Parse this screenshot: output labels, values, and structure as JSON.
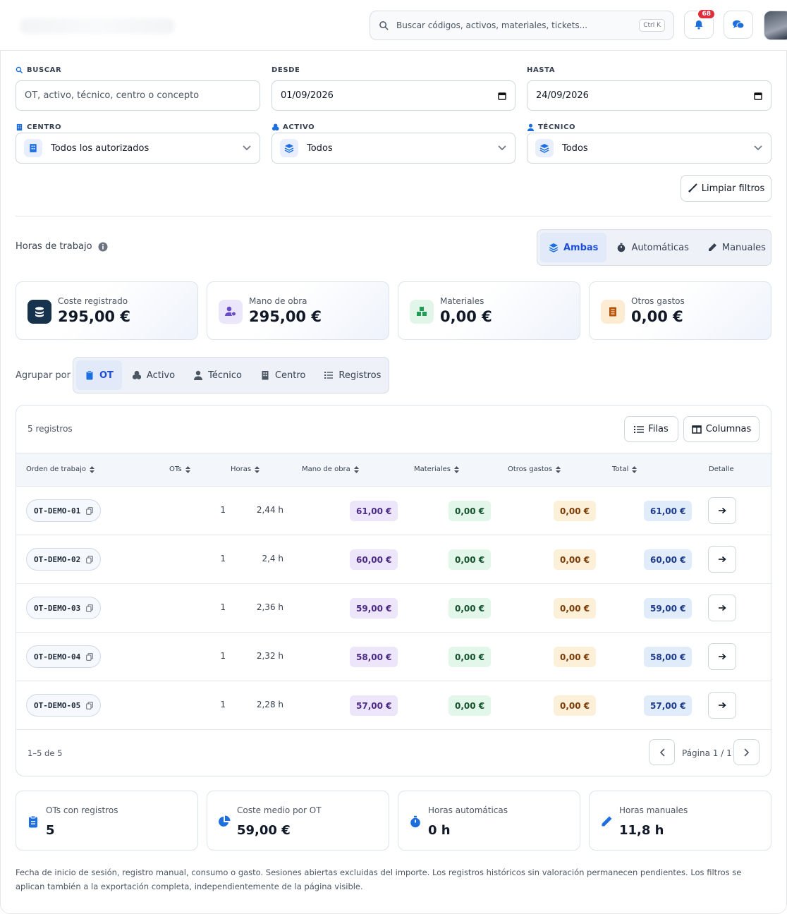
{
  "topbar": {
    "search_placeholder": "Buscar códigos, activos, materiales, tickets...",
    "shortcut": "Ctrl K",
    "notifications_count": "68"
  },
  "filters": {
    "search_label": "BUSCAR",
    "search_placeholder": "OT, activo, técnico, centro o concepto",
    "from_label": "DESDE",
    "from_value": "01/09/2026",
    "to_label": "HASTA",
    "to_value": "24/09/2026",
    "center_label": "CENTRO",
    "center_value": "Todos los autorizados",
    "asset_label": "ACTIVO",
    "asset_value": "Todos",
    "tech_label": "TÉCNICO",
    "tech_value": "Todos",
    "clear_label": "Limpiar filtros"
  },
  "hours": {
    "title": "Horas de trabajo",
    "modes": [
      "Ambas",
      "Automáticas",
      "Manuales"
    ],
    "active_mode": "Ambas"
  },
  "summary_cards": [
    {
      "label": "Coste registrado",
      "value": "295,00 €",
      "icon": "coins-icon"
    },
    {
      "label": "Mano de obra",
      "value": "295,00 €",
      "icon": "user-cost-icon"
    },
    {
      "label": "Materiales",
      "value": "0,00 €",
      "icon": "boxes-icon"
    },
    {
      "label": "Otros gastos",
      "value": "0,00 €",
      "icon": "receipt-icon"
    }
  ],
  "group": {
    "label": "Agrupar por",
    "options": [
      "OT",
      "Activo",
      "Técnico",
      "Centro",
      "Registros"
    ],
    "active": "OT"
  },
  "table": {
    "count_text": "5 registros",
    "rows_button": "Filas",
    "columns_button": "Columnas",
    "headers": [
      "Orden de trabajo",
      "OTs",
      "Horas",
      "Mano de obra",
      "Materiales",
      "Otros gastos",
      "Total",
      "Detalle"
    ],
    "rows": [
      {
        "ot": "OT-DEMO-01",
        "ots": "1",
        "hours": "2,44 h",
        "labor": "61,00 €",
        "materials": "0,00 €",
        "other": "0,00 €",
        "total": "61,00 €"
      },
      {
        "ot": "OT-DEMO-02",
        "ots": "1",
        "hours": "2,4 h",
        "labor": "60,00 €",
        "materials": "0,00 €",
        "other": "0,00 €",
        "total": "60,00 €"
      },
      {
        "ot": "OT-DEMO-03",
        "ots": "1",
        "hours": "2,36 h",
        "labor": "59,00 €",
        "materials": "0,00 €",
        "other": "0,00 €",
        "total": "59,00 €"
      },
      {
        "ot": "OT-DEMO-04",
        "ots": "1",
        "hours": "2,32 h",
        "labor": "58,00 €",
        "materials": "0,00 €",
        "other": "0,00 €",
        "total": "58,00 €"
      },
      {
        "ot": "OT-DEMO-05",
        "ots": "1",
        "hours": "2,28 h",
        "labor": "57,00 €",
        "materials": "0,00 €",
        "other": "0,00 €",
        "total": "57,00 €"
      }
    ],
    "range_text": "1–5 de 5",
    "page_text": "Página 1 / 1"
  },
  "stats": [
    {
      "label": "OTs con registros",
      "value": "5",
      "icon": "clipboard-icon"
    },
    {
      "label": "Coste medio por OT",
      "value": "59,00 €",
      "icon": "pie-icon"
    },
    {
      "label": "Horas automáticas",
      "value": "0 h",
      "icon": "stopwatch-icon"
    },
    {
      "label": "Horas manuales",
      "value": "11,8 h",
      "icon": "pencil-icon"
    }
  ],
  "footnote": "Fecha de inicio de sesión, registro manual, consumo o gasto. Sesiones abiertas excluidas del importe. Los registros históricos sin valoración permanecen pendientes. Los filtros se aplican también a la exportación completa, independientemente de la página visible.",
  "colors": {
    "accent": "#1d6fe0",
    "dark_icon": "#17324d"
  }
}
